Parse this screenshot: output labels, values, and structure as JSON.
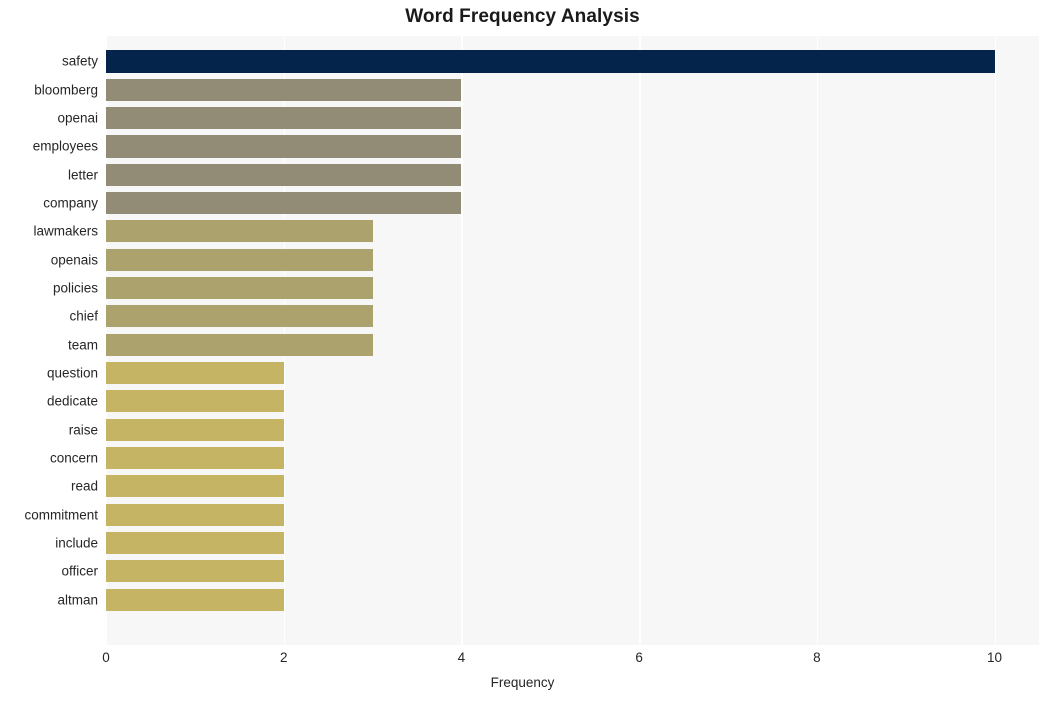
{
  "chart_data": {
    "type": "bar",
    "orientation": "horizontal",
    "title": "Word Frequency Analysis",
    "xlabel": "Frequency",
    "ylabel": "",
    "categories": [
      "safety",
      "bloomberg",
      "openai",
      "employees",
      "letter",
      "company",
      "lawmakers",
      "openais",
      "policies",
      "chief",
      "team",
      "question",
      "dedicate",
      "raise",
      "concern",
      "read",
      "commitment",
      "include",
      "officer",
      "altman"
    ],
    "values": [
      10,
      4,
      4,
      4,
      4,
      4,
      3,
      3,
      3,
      3,
      3,
      2,
      2,
      2,
      2,
      2,
      2,
      2,
      2,
      2
    ],
    "bar_colors": [
      "#04244c",
      "#928c76",
      "#928c76",
      "#928c76",
      "#928c76",
      "#928c76",
      "#aba26d",
      "#aba26d",
      "#aba26d",
      "#aba26d",
      "#aba26d",
      "#c4b463",
      "#c4b463",
      "#c4b463",
      "#c4b463",
      "#c4b463",
      "#c4b463",
      "#c4b463",
      "#c4b463",
      "#c4b463"
    ],
    "xlim": [
      0,
      10.5
    ],
    "xticks": [
      0,
      2,
      4,
      6,
      8,
      10
    ],
    "xtick_labels": [
      "0",
      "2",
      "4",
      "6",
      "8",
      "10"
    ],
    "grid": true,
    "grid_axis": "x",
    "grid_color": "#ffffff",
    "plot_background": "#f7f7f7",
    "figure_background": "#ffffff",
    "legend": null
  }
}
